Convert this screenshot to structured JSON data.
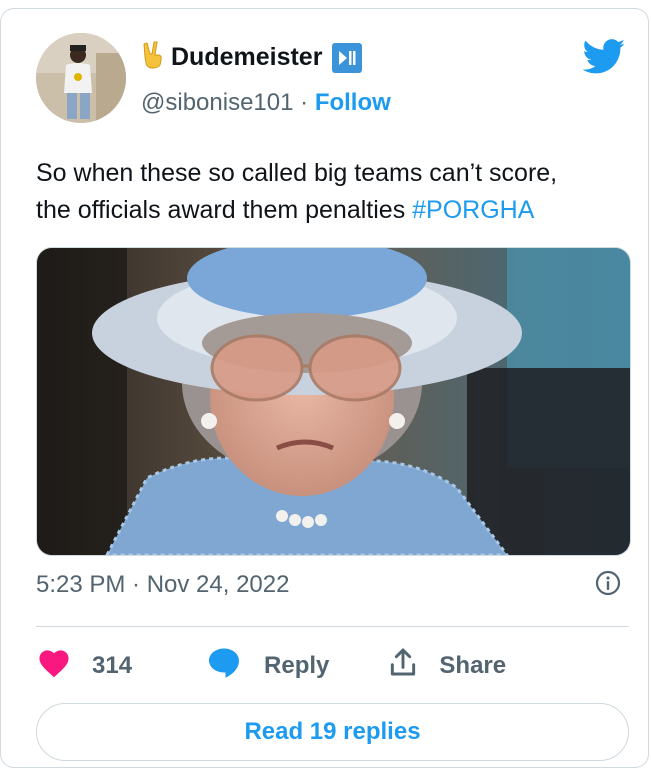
{
  "user": {
    "display_name": "Dudemeister",
    "handle": "@sibonise101",
    "separator": "·",
    "follow_label": "Follow"
  },
  "tweet": {
    "text_line1": "So when these so called big teams can’t score,",
    "text_line2": "the officials award them penalties ",
    "hashtag": "#PORGHA",
    "timestamp": "5:23 PM · Nov 24, 2022"
  },
  "actions": {
    "like_count": "314",
    "reply_label": "Reply",
    "share_label": "Share"
  },
  "read_replies_label": "Read 19 replies",
  "icons": {
    "name_emoji": "victory-hand-icon",
    "badge": "play-pause-icon",
    "brand": "twitter-bird-icon",
    "info": "info-icon",
    "like": "heart-icon",
    "reply": "speech-bubble-icon",
    "share": "share-upload-icon"
  },
  "colors": {
    "accent": "#1d9bf0",
    "like": "#f91880",
    "muted": "#536471",
    "text": "#0f1419"
  }
}
